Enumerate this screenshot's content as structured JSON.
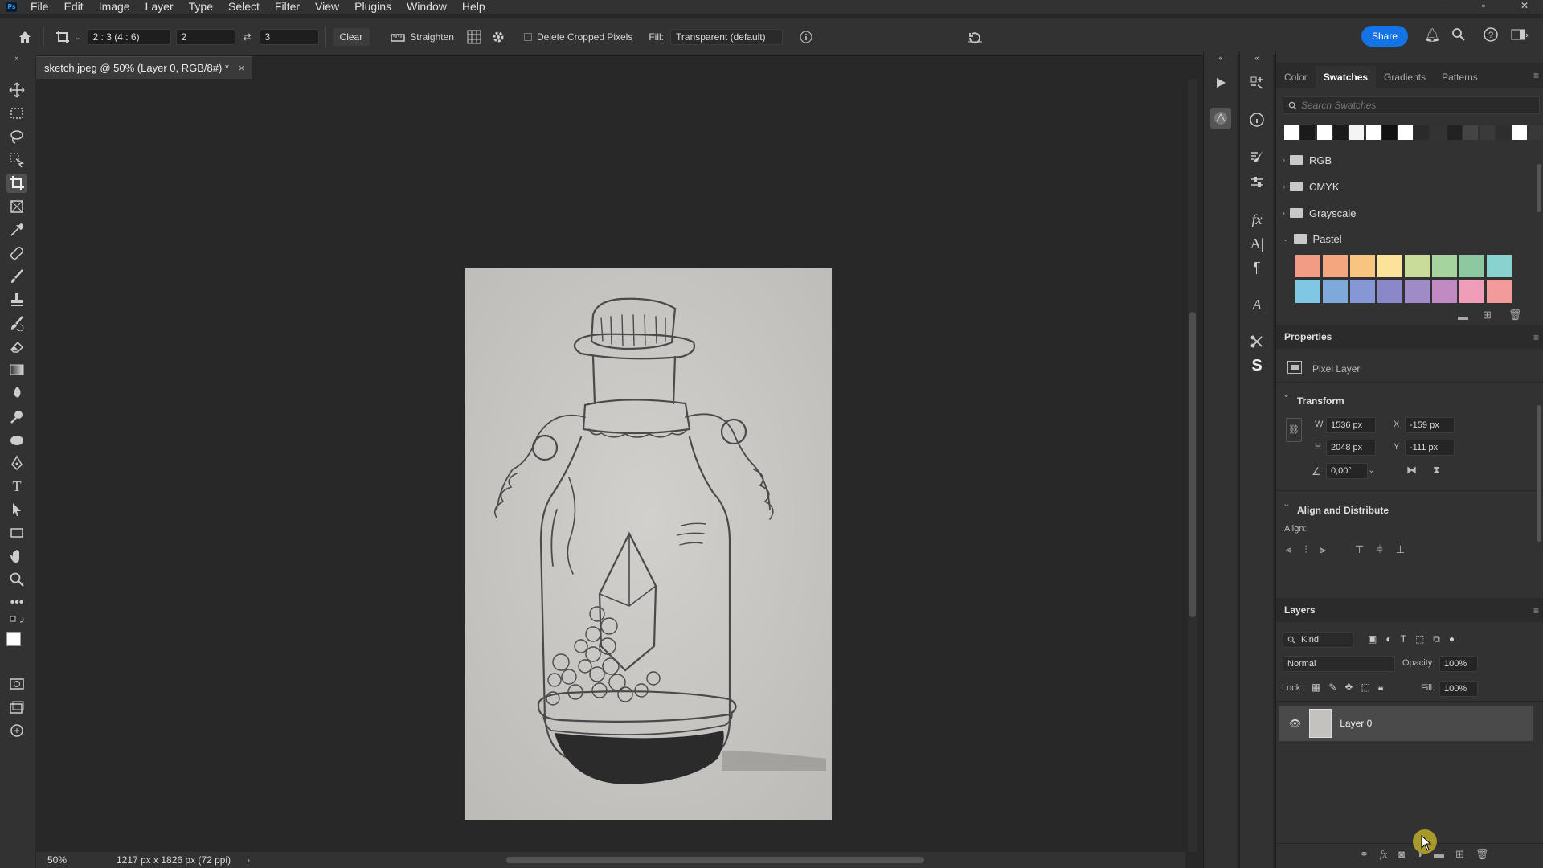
{
  "menubar": {
    "logo": "Ps",
    "items": [
      "File",
      "Edit",
      "Image",
      "Layer",
      "Type",
      "Select",
      "Filter",
      "View",
      "Plugins",
      "Window",
      "Help"
    ]
  },
  "optionsbar": {
    "ratio": "2 : 3 (4 : 6)",
    "width_value": "2",
    "height_value": "3",
    "clear_label": "Clear",
    "straighten_label": "Straighten",
    "delete_cropped_label": "Delete Cropped Pixels",
    "fill_label": "Fill:",
    "fill_value": "Transparent (default)",
    "share_label": "Share"
  },
  "document": {
    "tab_title": "sketch.jpeg @ 50% (Layer 0, RGB/8#) *",
    "close": "×"
  },
  "statusbar": {
    "zoom": "50%",
    "info": "1217 px x 1826 px (72 ppi)"
  },
  "swatches_panel": {
    "tabs": [
      "Color",
      "Swatches",
      "Gradients",
      "Patterns"
    ],
    "active_tab": "Swatches",
    "search_placeholder": "Search Swatches",
    "recent_colors": [
      "#ffffff",
      "#1a1a1a",
      "#ffffff",
      "#1a1a1a",
      "#f4f4f4",
      "#ffffff",
      "#111111",
      "#ffffff",
      "#2a2a2a",
      "#333333",
      "#222222",
      "#444444",
      "#3a3a3a",
      "#2e2e2e",
      "#ffffff",
      "#383838"
    ],
    "folders": [
      "RGB",
      "CMYK",
      "Grayscale",
      "Pastel"
    ],
    "pastel_row1": [
      "#f29c86",
      "#f4a67e",
      "#f7c57f",
      "#fbe49a",
      "#c9dc99",
      "#a6d49e",
      "#8cc9a0",
      "#88d2cf"
    ],
    "pastel_row2": [
      "#80c7e4",
      "#7fa8db",
      "#8597d4",
      "#8b88c8",
      "#9f8bc6",
      "#c08bc2",
      "#ef9db8",
      "#f39a9a"
    ]
  },
  "properties": {
    "title": "Properties",
    "layer_type": "Pixel Layer",
    "transform_title": "Transform",
    "w_label": "W",
    "w_value": "1536 px",
    "h_label": "H",
    "h_value": "2048 px",
    "x_label": "X",
    "x_value": "-159 px",
    "y_label": "Y",
    "y_value": "-111 px",
    "angle_value": "0,00°",
    "align_title": "Align and Distribute",
    "align_label": "Align:"
  },
  "layers": {
    "title": "Layers",
    "kind_label": "Kind",
    "blend_mode": "Normal",
    "opacity_label": "Opacity:",
    "opacity_value": "100%",
    "lock_label": "Lock:",
    "fill_label": "Fill:",
    "fill_value": "100%",
    "layer_name": "Layer 0"
  }
}
